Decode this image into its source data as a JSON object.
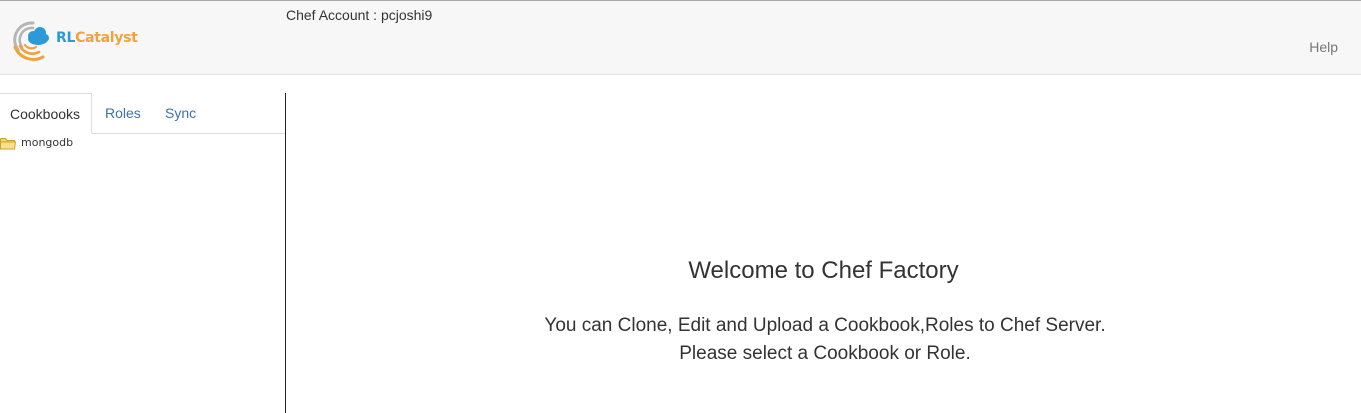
{
  "header": {
    "logo": {
      "text_rl": "RL",
      "text_catalyst": "Catalyst",
      "icon": "rlcatalyst-logo-icon"
    },
    "account_label": "Chef Account : pcjoshi9",
    "help_label": "Help"
  },
  "sidebar": {
    "tabs": [
      {
        "label": "Cookbooks",
        "active": true
      },
      {
        "label": "Roles",
        "active": false
      },
      {
        "label": "Sync",
        "active": false
      }
    ],
    "tree": [
      {
        "label": "mongodb",
        "icon": "folder-icon"
      }
    ]
  },
  "main": {
    "title": "Welcome to Chef Factory",
    "line1": "You can Clone, Edit and Upload a Cookbook,Roles to Chef Server.",
    "line2": "Please select a Cookbook or Role."
  },
  "colors": {
    "brand_blue": "#2d9ad8",
    "brand_orange": "#f0a33a",
    "link": "#3a72b0",
    "header_bg": "#f7f7f7"
  }
}
